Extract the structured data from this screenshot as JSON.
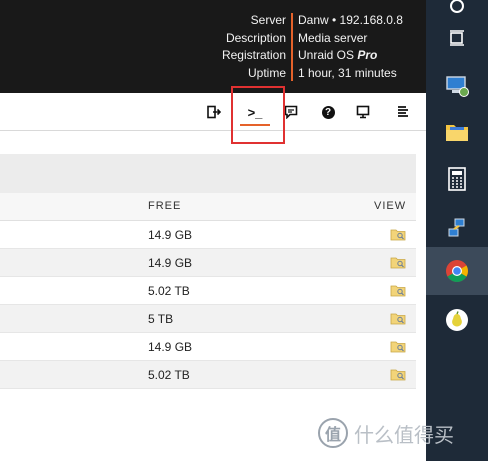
{
  "server_info": {
    "labels": [
      "Server",
      "Description",
      "Registration",
      "Uptime"
    ],
    "server": "Danw • 192.168.0.8",
    "description": "Media server",
    "registration_prefix": "Unraid OS",
    "registration_tier": "Pro",
    "uptime": "1 hour, 31 minutes"
  },
  "toolbar": {
    "buttons": [
      "logout-icon",
      "terminal-icon",
      "feedback-icon",
      "help-icon",
      "info-icon",
      "log-icon"
    ],
    "active": "terminal-icon",
    "terminal_glyph": ">_",
    "help_glyph": "?"
  },
  "table": {
    "columns": {
      "free": "FREE",
      "view": "VIEW"
    },
    "rows": [
      {
        "free": "14.9 GB"
      },
      {
        "free": "14.9 GB"
      },
      {
        "free": "5.02 TB"
      },
      {
        "free": "5 TB"
      },
      {
        "free": "14.9 GB"
      },
      {
        "free": "5.02 TB"
      }
    ]
  },
  "taskbar": {
    "items": [
      "network-icon",
      "window-icon",
      "computer-icon",
      "folder-icon",
      "calculator-icon",
      "network-share-icon",
      "chrome-icon",
      "pear-app-icon"
    ],
    "active": "chrome-icon"
  },
  "watermark": {
    "logo": "值",
    "text": "什么值得买"
  },
  "colors": {
    "accent": "#e5622a",
    "highlight": "#e03131",
    "header_bg": "#191919",
    "taskbar_bg": "#1e2a38"
  }
}
